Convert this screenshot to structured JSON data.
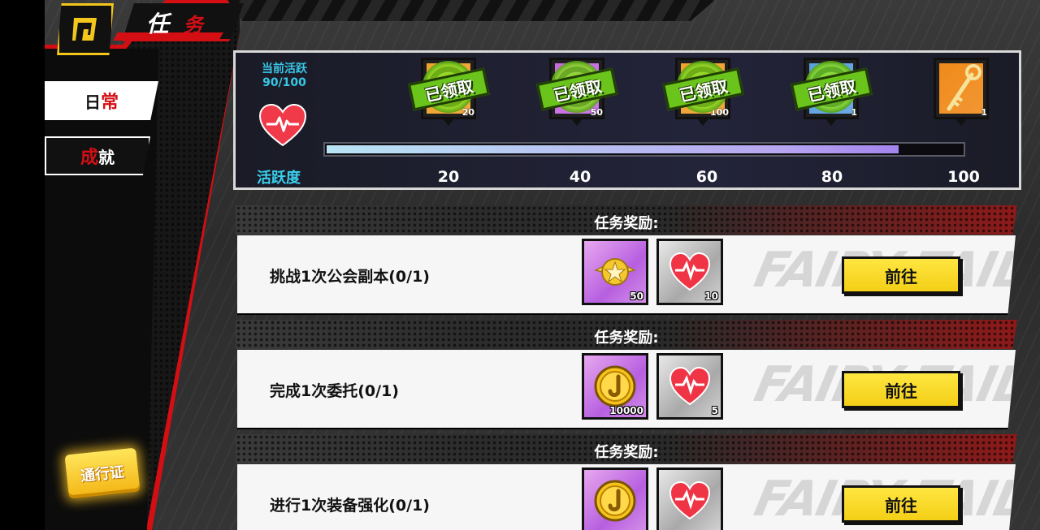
{
  "header": {
    "title_first": "任",
    "title_second": "务"
  },
  "sidebar": {
    "tabs": [
      {
        "label_plain": "日",
        "label_highlight": "常"
      },
      {
        "label_highlight": "成",
        "label_plain": "就"
      }
    ],
    "pass_button": "通行证"
  },
  "activity": {
    "current_label": "当前活跃",
    "current_value": "90/100",
    "progress_fraction": 0.9,
    "label": "活跃度",
    "milestones": [
      {
        "value": "20",
        "status": "已领取",
        "qty": "20",
        "color": "#f0a12a"
      },
      {
        "value": "40",
        "status": "已领取",
        "qty": "50",
        "color": "#c56be0"
      },
      {
        "value": "60",
        "status": "已领取",
        "qty": "100",
        "color": "#f0a12a"
      },
      {
        "value": "80",
        "status": "已领取",
        "qty": "1",
        "color": "#5a9fe0"
      },
      {
        "value": "100",
        "status": "",
        "qty": "1",
        "color": "#f08a1a"
      }
    ]
  },
  "tasks": [
    {
      "reward_header": "任务奖励:",
      "name": "挑战1次公会副本(0/1)",
      "rewards": [
        {
          "icon": "medal-icon",
          "qty": "50"
        },
        {
          "icon": "heart-icon",
          "qty": "10"
        }
      ],
      "button": "前往"
    },
    {
      "reward_header": "任务奖励:",
      "name": "完成1次委托(0/1)",
      "rewards": [
        {
          "icon": "coin-icon",
          "qty": "10000"
        },
        {
          "icon": "heart-icon",
          "qty": "5"
        }
      ],
      "button": "前往"
    },
    {
      "reward_header": "任务奖励:",
      "name": "进行1次装备强化(0/1)",
      "rewards": [
        {
          "icon": "coin-icon",
          "qty": ""
        },
        {
          "icon": "heart-icon",
          "qty": ""
        }
      ],
      "button": "前往"
    }
  ],
  "watermark": "FAIRY TAIL"
}
